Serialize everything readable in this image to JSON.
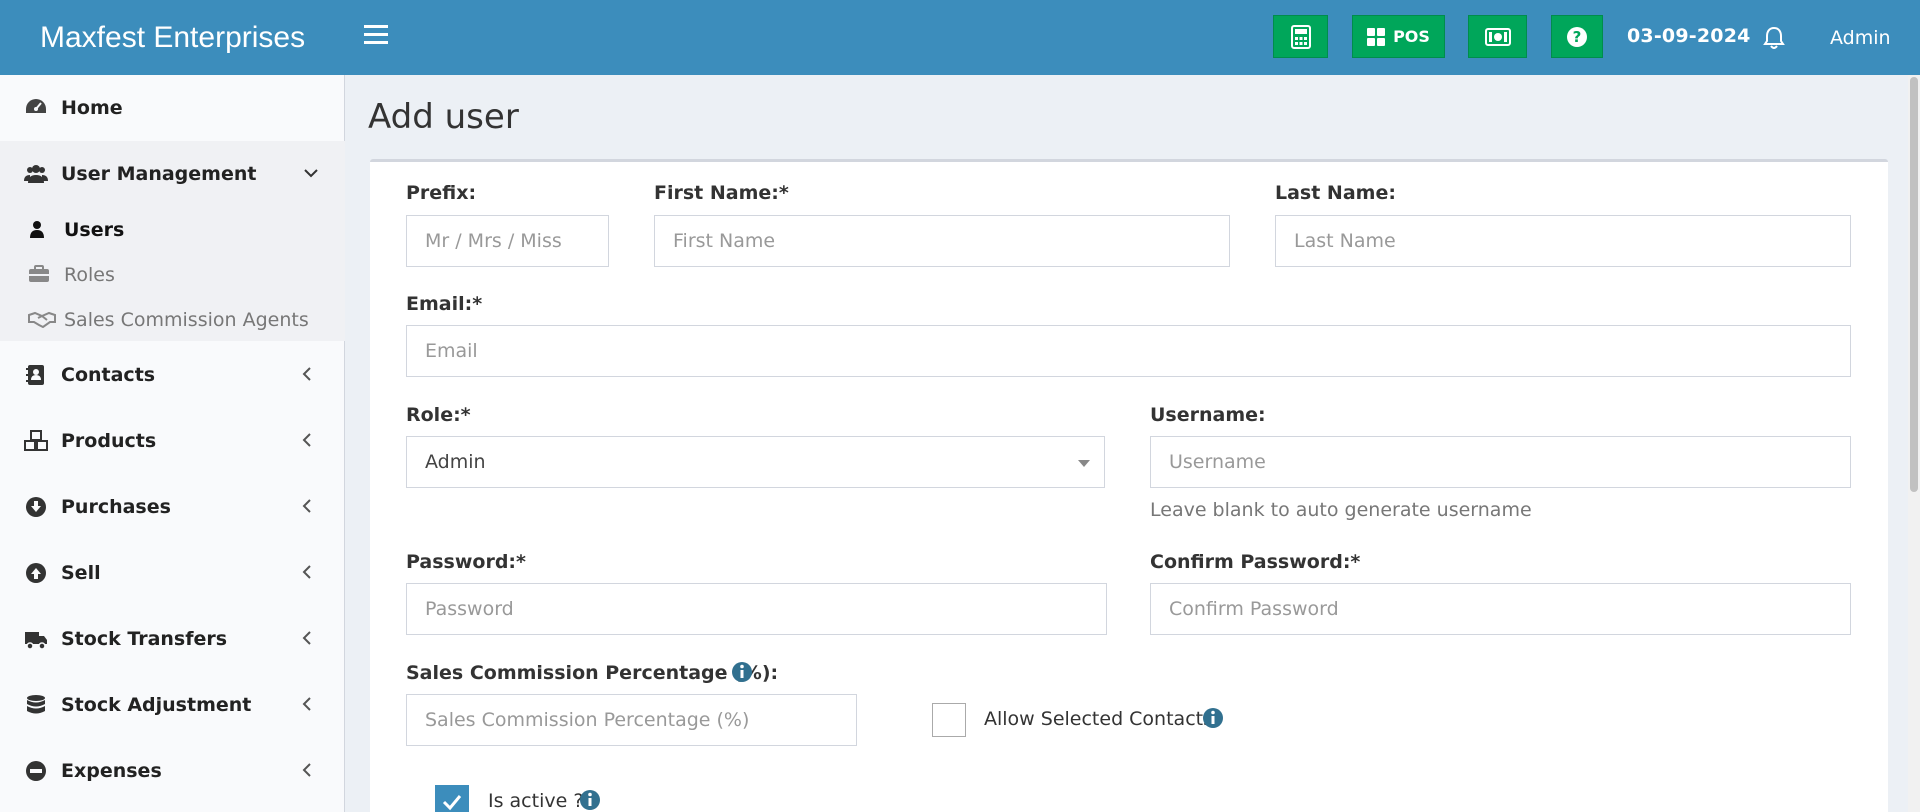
{
  "app": {
    "brand": "Maxfest Enterprises"
  },
  "header": {
    "pos_label": "POS",
    "date": "03-09-2024",
    "user": "Admin",
    "colors": {
      "bar": "#3c8dbc",
      "button": "#00a65a"
    }
  },
  "sidebar": {
    "items": [
      {
        "label": "Home",
        "icon": "dashboard-icon"
      },
      {
        "label": "User Management",
        "icon": "users-icon",
        "expanded": true,
        "children": [
          {
            "label": "Users",
            "icon": "user-icon",
            "active": true
          },
          {
            "label": "Roles",
            "icon": "briefcase-icon"
          },
          {
            "label": "Sales Commission Agents",
            "icon": "handshake-icon"
          }
        ]
      },
      {
        "label": "Contacts",
        "icon": "address-book-icon"
      },
      {
        "label": "Products",
        "icon": "cubes-icon"
      },
      {
        "label": "Purchases",
        "icon": "arrow-circle-down-icon"
      },
      {
        "label": "Sell",
        "icon": "arrow-circle-up-icon"
      },
      {
        "label": "Stock Transfers",
        "icon": "truck-icon"
      },
      {
        "label": "Stock Adjustment",
        "icon": "database-icon"
      },
      {
        "label": "Expenses",
        "icon": "minus-circle-icon"
      }
    ]
  },
  "page": {
    "title": "Add user"
  },
  "form": {
    "prefix": {
      "label": "Prefix:",
      "placeholder": "Mr / Mrs / Miss"
    },
    "first_name": {
      "label": "First Name:*",
      "placeholder": "First Name"
    },
    "last_name": {
      "label": "Last Name:",
      "placeholder": "Last Name"
    },
    "email": {
      "label": "Email:*",
      "placeholder": "Email"
    },
    "role": {
      "label": "Role:*",
      "value": "Admin"
    },
    "username": {
      "label": "Username:",
      "placeholder": "Username",
      "help": "Leave blank to auto generate username"
    },
    "password": {
      "label": "Password:*",
      "placeholder": "Password"
    },
    "confirm_password": {
      "label": "Confirm Password:*",
      "placeholder": "Confirm Password"
    },
    "commission": {
      "label": "Sales Commission Percentage (%):",
      "placeholder": "Sales Commission Percentage (%)"
    },
    "allow_contacts": {
      "label": "Allow Selected Contacts",
      "checked": false
    },
    "is_active": {
      "label": "Is active ?",
      "checked": true
    }
  }
}
